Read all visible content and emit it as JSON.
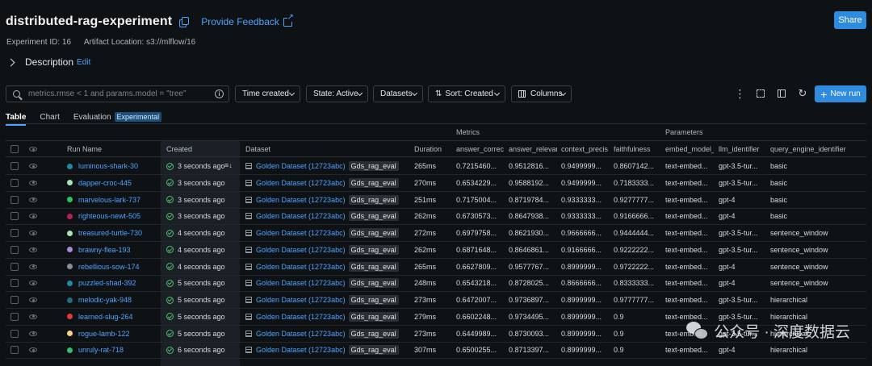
{
  "header": {
    "title": "distributed-rag-experiment",
    "feedback_label": "Provide Feedback",
    "share_label": "Share",
    "experiment_id": "Experiment ID: 16",
    "artifact_location": "Artifact Location: s3://mlflow/16",
    "description_label": "Description",
    "edit_label": "Edit"
  },
  "toolbar": {
    "search_placeholder": "metrics.rmse < 1 and params.model = \"tree\"",
    "time_created": "Time created",
    "state": "State: Active",
    "datasets": "Datasets",
    "sort": "Sort: Created",
    "columns": "Columns",
    "new_run": "New run"
  },
  "tabs": [
    {
      "label": "Table"
    },
    {
      "label": "Chart"
    },
    {
      "label": "Evaluation"
    },
    {
      "label": "Experimental"
    }
  ],
  "groups": {
    "metrics": "Metrics",
    "parameters": "Parameters"
  },
  "columns": {
    "run_name": "Run Name",
    "created": "Created",
    "dataset": "Dataset",
    "duration": "Duration",
    "answer_correctness": "answer_correc",
    "answer_relevance": "answer_relevar",
    "context_precision": "context_precis",
    "faithfulness": "faithfulness",
    "embed_model": "embed_model_",
    "llm_identifier": "llm_identifier",
    "query_engine_identifier": "query_engine_identifier"
  },
  "rows": [
    {
      "color": "#1f8aa6",
      "name": "luminous-shark-30",
      "created": "3 seconds ago",
      "dataset": "Golden Dataset (12723abc)",
      "tag": "Gds_rag_eval",
      "duration": "265ms",
      "ac": "0.7215460...",
      "ar": "0.9512816...",
      "cp": "0.9499999...",
      "ff": "0.8607142...",
      "em": "text-embed...",
      "llm": "gpt-3.5-tur...",
      "qe": "basic"
    },
    {
      "color": "#a8e6b0",
      "name": "dapper-croc-445",
      "created": "3 seconds ago",
      "dataset": "Golden Dataset (12723abc)",
      "tag": "Gds_rag_eval",
      "duration": "270ms",
      "ac": "0.6534229...",
      "ar": "0.9588192...",
      "cp": "0.9499999...",
      "ff": "0.7183333...",
      "em": "text-embed...",
      "llm": "gpt-3.5-tur...",
      "qe": "basic"
    },
    {
      "color": "#2fbf6a",
      "name": "marvelous-lark-737",
      "created": "3 seconds ago",
      "dataset": "Golden Dataset (12723abc)",
      "tag": "Gds_rag_eval",
      "duration": "251ms",
      "ac": "0.7175004...",
      "ar": "0.8719784...",
      "cp": "0.9333333...",
      "ff": "0.9277777...",
      "em": "text-embed...",
      "llm": "gpt-4",
      "qe": "basic"
    },
    {
      "color": "#b3235a",
      "name": "righteous-newt-505",
      "created": "3 seconds ago",
      "dataset": "Golden Dataset (12723abc)",
      "tag": "Gds_rag_eval",
      "duration": "262ms",
      "ac": "0.6730573...",
      "ar": "0.8647938...",
      "cp": "0.9333333...",
      "ff": "0.9166666...",
      "em": "text-embed...",
      "llm": "gpt-4",
      "qe": "basic"
    },
    {
      "color": "#a8e6b0",
      "name": "treasured-turtle-730",
      "created": "4 seconds ago",
      "dataset": "Golden Dataset (12723abc)",
      "tag": "Gds_rag_eval",
      "duration": "272ms",
      "ac": "0.6979758...",
      "ar": "0.8621930...",
      "cp": "0.9666666...",
      "ff": "0.9444444...",
      "em": "text-embed...",
      "llm": "gpt-3.5-tur...",
      "qe": "sentence_window"
    },
    {
      "color": "#a98ad6",
      "name": "brawny-flea-193",
      "created": "4 seconds ago",
      "dataset": "Golden Dataset (12723abc)",
      "tag": "Gds_rag_eval",
      "duration": "262ms",
      "ac": "0.6871648...",
      "ar": "0.8646861...",
      "cp": "0.9166666...",
      "ff": "0.9222222...",
      "em": "text-embed...",
      "llm": "gpt-3.5-tur...",
      "qe": "sentence_window"
    },
    {
      "color": "#8a8f94",
      "name": "rebellious-sow-174",
      "created": "4 seconds ago",
      "dataset": "Golden Dataset (12723abc)",
      "tag": "Gds_rag_eval",
      "duration": "265ms",
      "ac": "0.6627809...",
      "ar": "0.9577767...",
      "cp": "0.8999999...",
      "ff": "0.9722222...",
      "em": "text-embed...",
      "llm": "gpt-4",
      "qe": "sentence_window"
    },
    {
      "color": "#1f8aa6",
      "name": "puzzled-shad-392",
      "created": "5 seconds ago",
      "dataset": "Golden Dataset (12723abc)",
      "tag": "Gds_rag_eval",
      "duration": "248ms",
      "ac": "0.6543218...",
      "ar": "0.8728025...",
      "cp": "0.8666666...",
      "ff": "0.8333333...",
      "em": "text-embed...",
      "llm": "gpt-4",
      "qe": "sentence_window"
    },
    {
      "color": "#1e6e7e",
      "name": "melodic-yak-948",
      "created": "5 seconds ago",
      "dataset": "Golden Dataset (12723abc)",
      "tag": "Gds_rag_eval",
      "duration": "273ms",
      "ac": "0.6472007...",
      "ar": "0.9736897...",
      "cp": "0.8999999...",
      "ff": "0.9777777...",
      "em": "text-embed...",
      "llm": "gpt-3.5-tur...",
      "qe": "hierarchical"
    },
    {
      "color": "#e03b3b",
      "name": "learned-slug-264",
      "created": "5 seconds ago",
      "dataset": "Golden Dataset (12723abc)",
      "tag": "Gds_rag_eval",
      "duration": "279ms",
      "ac": "0.6602248...",
      "ar": "0.9734495...",
      "cp": "0.8999999...",
      "ff": "0.9",
      "em": "text-embed...",
      "llm": "gpt-3.5-tur...",
      "qe": "hierarchical"
    },
    {
      "color": "#f0d58a",
      "name": "rogue-lamb-122",
      "created": "5 seconds ago",
      "dataset": "Golden Dataset (12723abc)",
      "tag": "Gds_rag_eval",
      "duration": "273ms",
      "ac": "0.6449989...",
      "ar": "0.8730093...",
      "cp": "0.8999999...",
      "ff": "0.9",
      "em": "text-embed...",
      "llm": "gpt-3.5-tur...",
      "qe": "hierarchical"
    },
    {
      "color": "#2fbf6a",
      "name": "unruly-rat-718",
      "created": "6 seconds ago",
      "dataset": "Golden Dataset (12723abc)",
      "tag": "Gds_rag_eval",
      "duration": "307ms",
      "ac": "0.6500255...",
      "ar": "0.8713397...",
      "cp": "0.8999999...",
      "ff": "0.9",
      "em": "text-embed...",
      "llm": "gpt-4",
      "qe": "hierarchical"
    }
  ],
  "watermark": {
    "text": "公众号 · 深度数据云"
  },
  "icons": [
    "copy-icon",
    "external-link-icon",
    "chevron-right-icon",
    "search-icon",
    "info-icon",
    "caret-down-icon",
    "sort-icon",
    "columns-icon",
    "kebab-icon",
    "expand-icon",
    "panel-icon",
    "refresh-icon",
    "plus-icon",
    "eye-icon",
    "check-circle-icon",
    "table-icon",
    "wechat-icon"
  ]
}
